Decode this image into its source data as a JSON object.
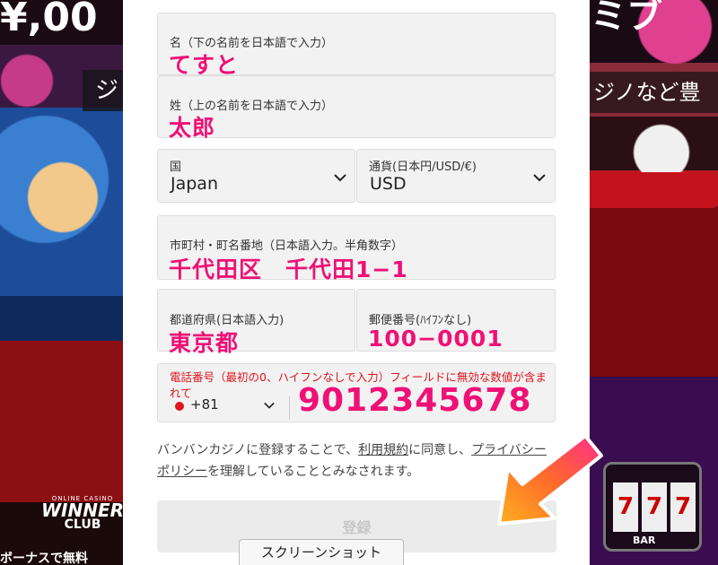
{
  "background": {
    "title_left": "¥,00",
    "title_right": "ミブ",
    "band_left": "ジ",
    "band_right": "ジノなど豊",
    "bottom_left": "ボーナスで無料",
    "logo": {
      "small": "ONLINE CASINO",
      "big": "WINNER",
      "club": "CLUB"
    },
    "slot_reel": "7",
    "slot_bar": "BAR"
  },
  "form": {
    "first_name": {
      "label": "名（下の名前を日本語で入力）",
      "value": "てすと"
    },
    "last_name": {
      "label": "姓（上の名前を日本語で入力）",
      "value": "太郎"
    },
    "country": {
      "label": "国",
      "value": "Japan"
    },
    "currency": {
      "label": "通貨(日本円/USD/€)",
      "value": "USD"
    },
    "address": {
      "label": "市町村・町名番地（日本語入力。半角数字）",
      "value": "千代田区　千代田1−1"
    },
    "prefecture": {
      "label": "都道府県(日本語入力)",
      "value": "東京都"
    },
    "postal": {
      "label": "郵便番号(ﾊｲﾌﾝなし)",
      "value": "100−0001"
    },
    "phone": {
      "error": "電話番号（最初の0、ハイフンなしで入力）フィールドに無効な数値が含まれて",
      "dial_code": "+81",
      "value": "9012345678"
    },
    "consent": {
      "part1": "バンバンカジノに登録することで、",
      "terms_link": "利用規約",
      "part2": "に同意し、",
      "privacy_link": "プライバシーポリシー",
      "part3": "を理解していることとみなされます。"
    },
    "register_label": "登録"
  },
  "screenshot_tab": "スクリーンショット",
  "colors": {
    "accent_pink": "#ef1176",
    "error_red": "#e0141c",
    "arrow_orange": "#ff7a1a",
    "arrow_pink": "#ff2e8a"
  }
}
